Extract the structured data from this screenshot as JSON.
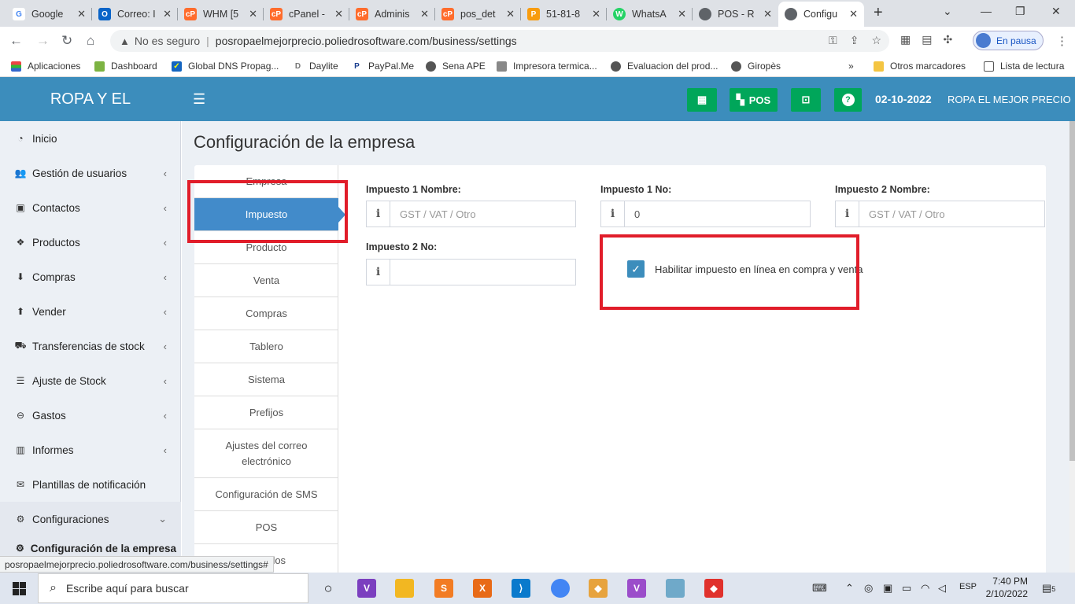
{
  "browser": {
    "tabs": [
      {
        "title": "Google",
        "icon": "google-icon",
        "color": "#4285f4"
      },
      {
        "title": "Correo: I",
        "icon": "outlook-icon",
        "color": "#0a64c8"
      },
      {
        "title": "WHM [5",
        "icon": "cpanel-icon",
        "color": "#ff6c2c"
      },
      {
        "title": "cPanel -",
        "icon": "cpanel-icon",
        "color": "#ff6c2c"
      },
      {
        "title": "Adminis",
        "icon": "cpanel-icon",
        "color": "#ff6c2c"
      },
      {
        "title": "pos_det",
        "icon": "cpanel-icon",
        "color": "#ff6c2c"
      },
      {
        "title": "51-81-8",
        "icon": "pma-icon",
        "color": "#f89c0e"
      },
      {
        "title": "WhatsA",
        "icon": "whatsapp-icon",
        "color": "#25d366"
      },
      {
        "title": "POS - R",
        "icon": "globe-icon",
        "color": "#5f6368"
      },
      {
        "title": "Configu",
        "icon": "globe-icon",
        "color": "#5f6368"
      }
    ],
    "security_label": "No es seguro",
    "url": "posropaelmejorprecio.poliedrosoftware.com/business/settings",
    "profile_label": "En pausa",
    "bookmarks": [
      {
        "label": "Aplicaciones",
        "icon": "apps-grid-icon"
      },
      {
        "label": "Dashboard",
        "icon": "dashboard-icon"
      },
      {
        "label": "Global DNS Propag...",
        "icon": "dns-icon"
      },
      {
        "label": "Daylite",
        "icon": "daylite-icon"
      },
      {
        "label": "PayPal.Me",
        "icon": "paypal-icon"
      },
      {
        "label": "Sena APE",
        "icon": "globe-icon"
      },
      {
        "label": "Impresora termica...",
        "icon": "printer-icon"
      },
      {
        "label": "Evaluacion del prod...",
        "icon": "globe-icon"
      },
      {
        "label": "Giropès",
        "icon": "globe-icon"
      }
    ],
    "bookmarks_overflow": "»",
    "other_bookmarks": "Otros marcadores",
    "reading_list": "Lista de lectura",
    "status_url": "posropaelmejorprecio.poliedrosoftware.com/business/settings#"
  },
  "header": {
    "logo": "ROPA Y EL",
    "pos_label": "POS",
    "date": "02-10-2022",
    "business": "ROPA EL MEJOR PRECIO"
  },
  "sidebar": {
    "items": [
      {
        "label": "Inicio",
        "icon": "dashboard-icon",
        "chevron": false
      },
      {
        "label": "Gestión de usuarios",
        "icon": "users-icon",
        "chevron": true
      },
      {
        "label": "Contactos",
        "icon": "address-book-icon",
        "chevron": true
      },
      {
        "label": "Productos",
        "icon": "cubes-icon",
        "chevron": true
      },
      {
        "label": "Compras",
        "icon": "arrow-circle-down-icon",
        "chevron": true
      },
      {
        "label": "Vender",
        "icon": "arrow-circle-up-icon",
        "chevron": true
      },
      {
        "label": "Transferencias de stock",
        "icon": "truck-icon",
        "chevron": true
      },
      {
        "label": "Ajuste de Stock",
        "icon": "database-icon",
        "chevron": true
      },
      {
        "label": "Gastos",
        "icon": "minus-circle-icon",
        "chevron": true
      },
      {
        "label": "Informes",
        "icon": "bar-chart-icon",
        "chevron": true
      },
      {
        "label": "Plantillas de notificación",
        "icon": "envelope-icon",
        "chevron": false
      },
      {
        "label": "Configuraciones",
        "icon": "cog-icon",
        "chevron": true
      }
    ],
    "sub_item": "Configuración de la empresa"
  },
  "page": {
    "title": "Configuración de la empresa",
    "tabs": [
      "Empresa",
      "Impuesto",
      "Producto",
      "Venta",
      "Compras",
      "Tablero",
      "Sistema",
      "Prefijos",
      "Ajustes del correo electrónico",
      "Configuración de SMS",
      "POS",
      "Módulos"
    ],
    "active_tab": "Impuesto",
    "fields": {
      "tax1_name": {
        "label": "Impuesto 1 Nombre:",
        "value": "",
        "placeholder": "GST / VAT / Otro"
      },
      "tax1_no": {
        "label": "Impuesto 1 No:",
        "value": "0",
        "placeholder": ""
      },
      "tax2_name": {
        "label": "Impuesto 2 Nombre:",
        "value": "",
        "placeholder": "GST / VAT / Otro"
      },
      "tax2_no": {
        "label": "Impuesto 2 No:",
        "value": "",
        "placeholder": ""
      }
    },
    "inline_tax_checkbox": {
      "label": "Habilitar impuesto en línea en compra y venta",
      "checked": true
    }
  },
  "taskbar": {
    "search_placeholder": "Escribe aquí para buscar",
    "language": "ESP",
    "time": "7:40 PM",
    "date": "2/10/2022",
    "notification_count": "5"
  },
  "colors": {
    "header_blue": "#3c8dbc",
    "active_tab_blue": "#428bca",
    "button_green": "#00a65a",
    "highlight_red": "#e11d2a"
  }
}
